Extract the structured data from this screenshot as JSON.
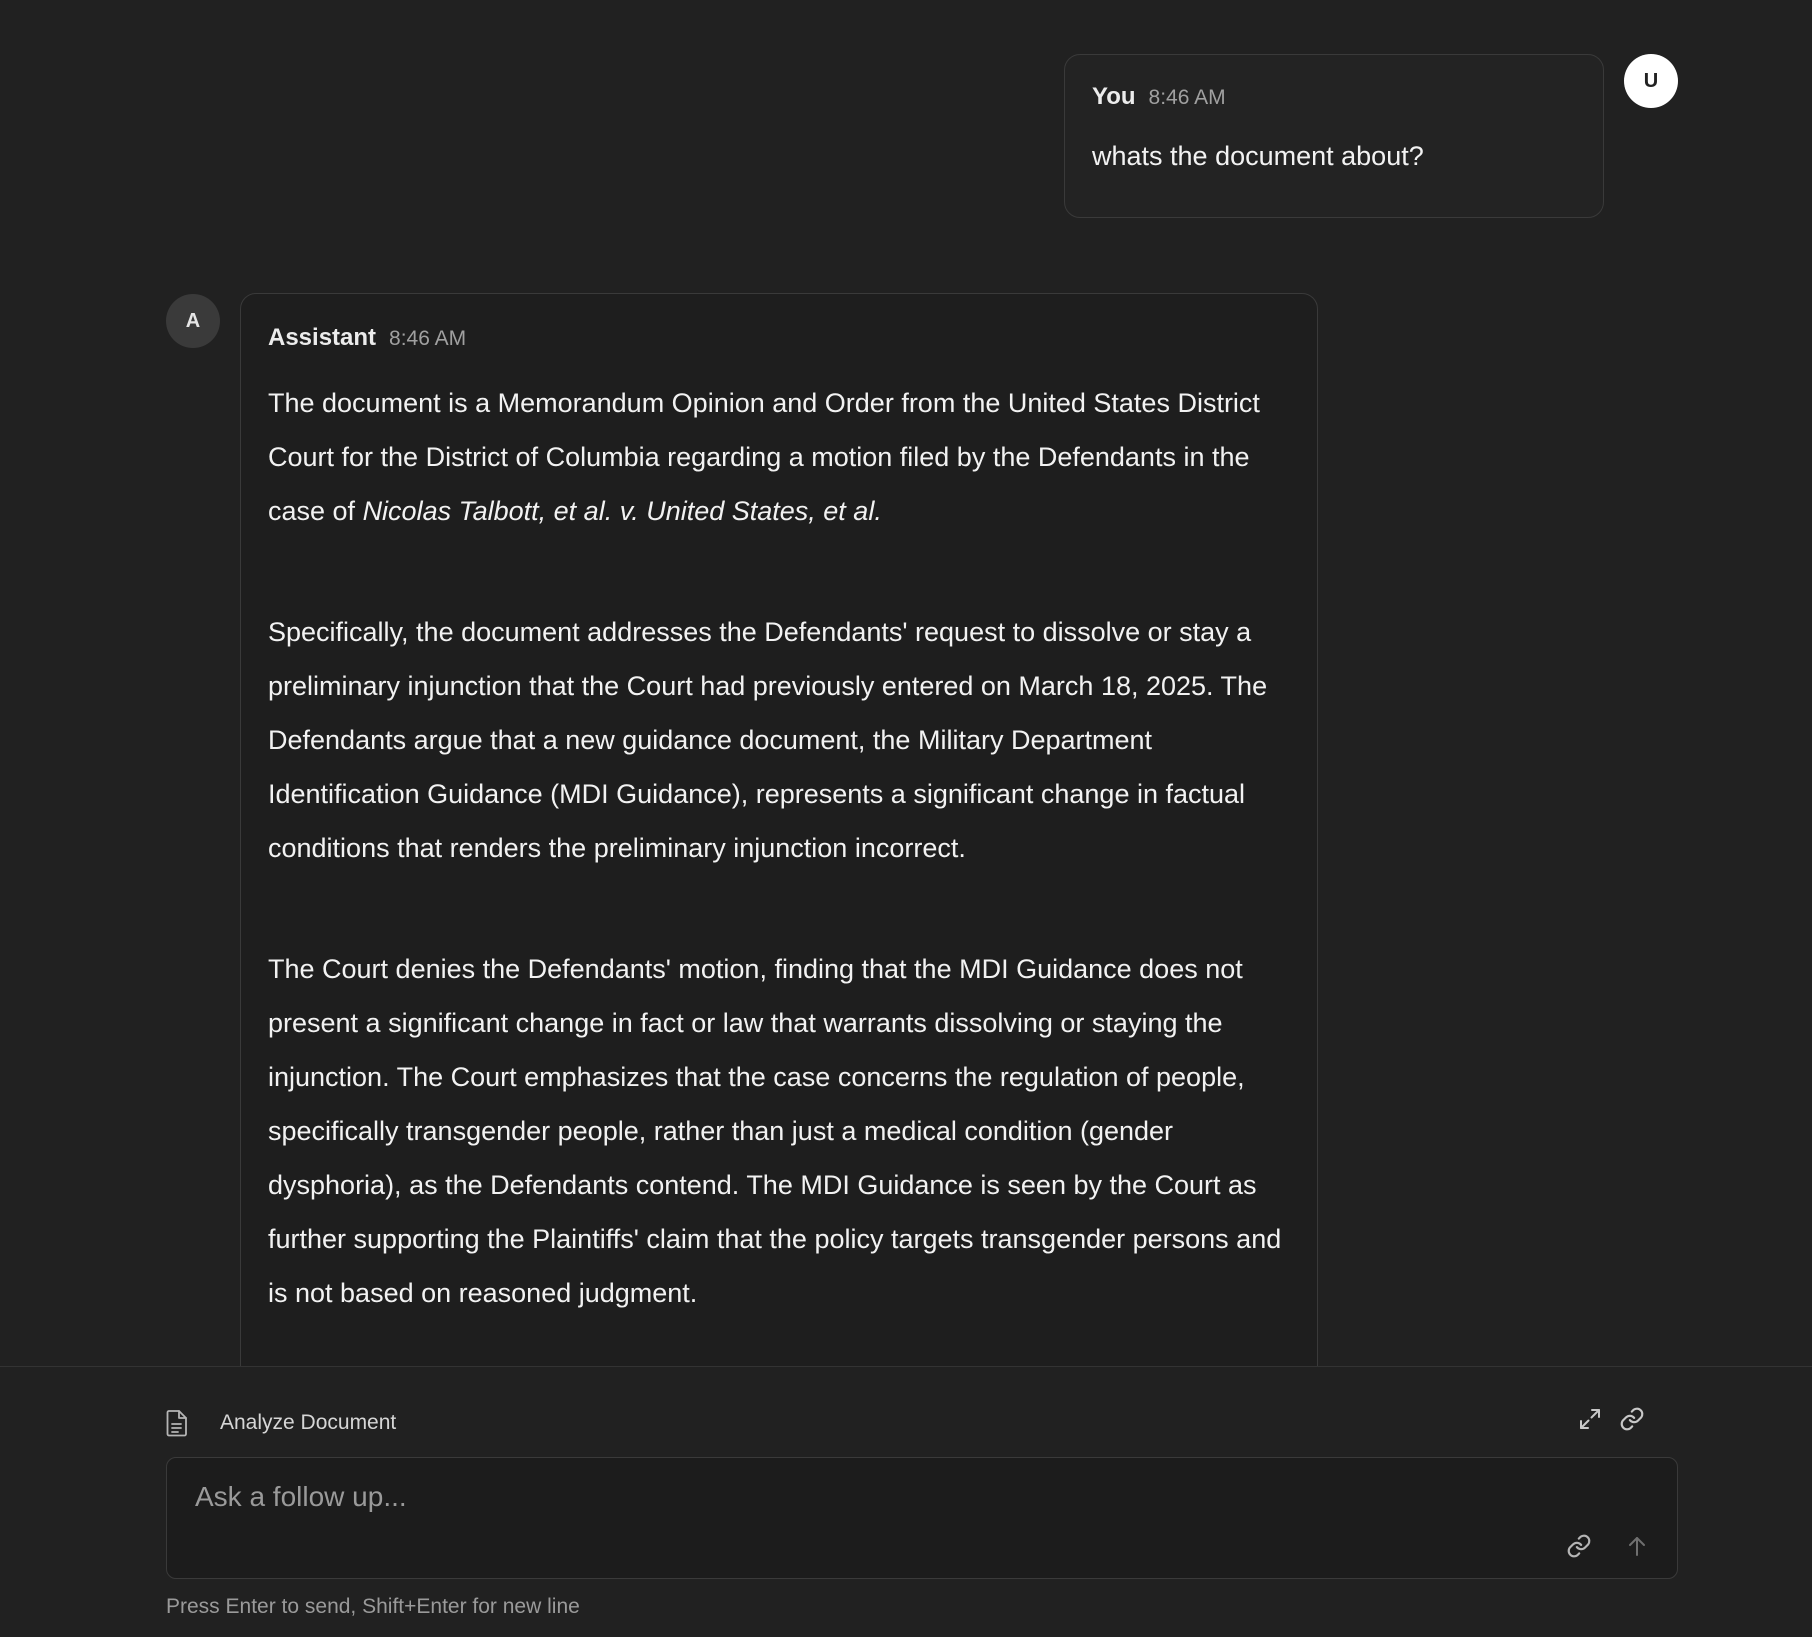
{
  "user_message": {
    "avatar_letter": "U",
    "sender": "You",
    "time": "8:46 AM",
    "text": "whats the document about?"
  },
  "assistant_message": {
    "avatar_letter": "A",
    "sender": "Assistant",
    "time": "8:46 AM",
    "paragraph1_prefix": "The document is a Memorandum Opinion and Order from the United States District Court for the District of Columbia regarding a motion filed by the Defendants in the case of ",
    "paragraph1_case": "Nicolas Talbott, et al. v. United States, et al.",
    "paragraph2": "Specifically, the document addresses the Defendants' request to dissolve or stay a preliminary injunction that the Court had previously entered on March 18, 2025. The Defendants argue that a new guidance document, the Military Department Identification Guidance (MDI Guidance), represents a significant change in factual conditions that renders the preliminary injunction incorrect.",
    "paragraph3": "The Court denies the Defendants' motion, finding that the MDI Guidance does not present a significant change in fact or law that warrants dissolving or staying the injunction. The Court emphasizes that the case concerns the regulation of people, specifically transgender people, rather than just a medical condition (gender dysphoria), as the Defendants contend. The MDI Guidance is seen by the Court as further supporting the Plaintiffs' claim that the policy targets transgender persons and is not based on reasoned judgment."
  },
  "composer": {
    "mode_icon": "document-icon",
    "mode_label": "Analyze Document",
    "expand_icon": "expand-icon",
    "link_icon": "link-icon",
    "placeholder": "Ask a follow up...",
    "attach_icon": "link-icon",
    "send_icon": "arrow-up-icon",
    "hint": "Press Enter to send, Shift+Enter for new line"
  },
  "colors": {
    "background": "#212121",
    "bubble_border": "#3a3a3a",
    "text": "#f2f2f2",
    "muted": "#9a9a9a"
  }
}
